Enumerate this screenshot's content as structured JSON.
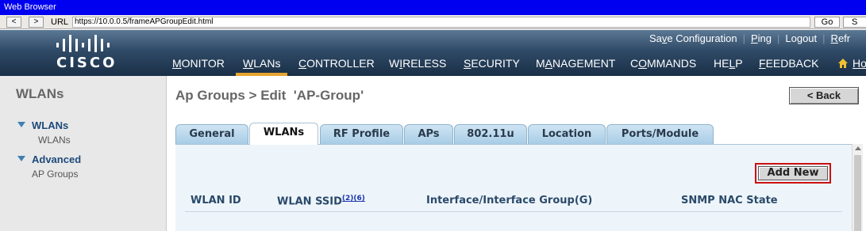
{
  "browser": {
    "title": "Web Browser",
    "back_label": "<",
    "forward_label": ">",
    "url_label": "URL",
    "url": "https://10.0.0.5/frameAPGroupEdit.html",
    "go_label": "Go",
    "extra_label": "S"
  },
  "header": {
    "logo_text": "CISCO",
    "top_links": [
      "Save Configuration",
      "Ping",
      "Logout",
      "Refr"
    ],
    "menu": [
      {
        "ul": "M",
        "rest": "ONITOR"
      },
      {
        "ul": "W",
        "rest": "LANs"
      },
      {
        "ul": "C",
        "rest": "ONTROLLER"
      },
      {
        "pre": "W",
        "ul": "I",
        "rest": "RELESS"
      },
      {
        "ul": "S",
        "rest": "ECURITY"
      },
      {
        "pre": "M",
        "ul": "A",
        "rest": "NAGEMENT"
      },
      {
        "pre": "C",
        "ul": "O",
        "rest": "MMANDS"
      },
      {
        "pre": "HE",
        "ul": "L",
        "rest": "P"
      },
      {
        "ul": "F",
        "rest": "EEDBACK"
      },
      {
        "ul": "Ho",
        "rest": ""
      }
    ],
    "active_menu": "WLANs"
  },
  "sidebar": {
    "title": "WLANs",
    "groups": [
      {
        "label": "WLANs",
        "items": [
          "WLANs"
        ]
      },
      {
        "label": "Advanced",
        "items": [
          "AP Groups"
        ]
      }
    ]
  },
  "main": {
    "page_title": "Ap Groups > Edit  'AP-Group'",
    "back_label": "< Back",
    "tabs": [
      "General",
      "WLANs",
      "RF Profile",
      "APs",
      "802.11u",
      "Location",
      "Ports/Module"
    ],
    "active_tab": "WLANs",
    "add_new_label": "Add New",
    "columns": [
      {
        "label": "WLAN ID"
      },
      {
        "label": "WLAN SSID",
        "sup": "(2)(6)"
      },
      {
        "label": "Interface/Interface Group(G)"
      },
      {
        "label": "SNMP NAC State"
      }
    ]
  },
  "colors": {
    "titlebar": "#0000f0",
    "header": "#2f4a66",
    "active_menu_underline": "#e8a430",
    "tab": "#a8cde6",
    "panel": "#eef5fa",
    "add_new_highlight": "#cc1010"
  }
}
